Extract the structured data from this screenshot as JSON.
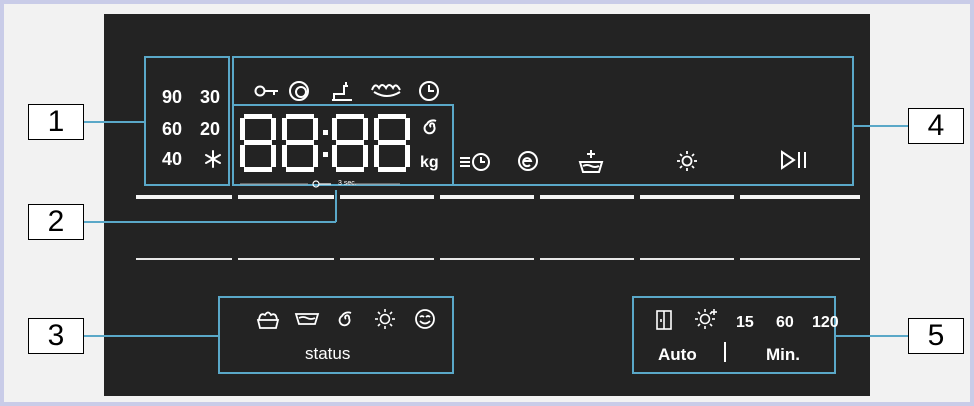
{
  "callouts": [
    "1",
    "2",
    "3",
    "4",
    "5"
  ],
  "temperatures": {
    "row1": [
      "90",
      "30"
    ],
    "row2": [
      "60",
      "20"
    ],
    "row3": [
      "40"
    ]
  },
  "display": {
    "digits": "88:88",
    "unit": "kg",
    "lock_hint": "3 sec."
  },
  "status_label": "status",
  "time_options": [
    "15",
    "60",
    "120"
  ],
  "mode_labels": {
    "auto": "Auto",
    "min": "Min."
  },
  "colors": {
    "panel": "#232323",
    "accent": "#5aa8c8",
    "background": "#c9cce8"
  }
}
